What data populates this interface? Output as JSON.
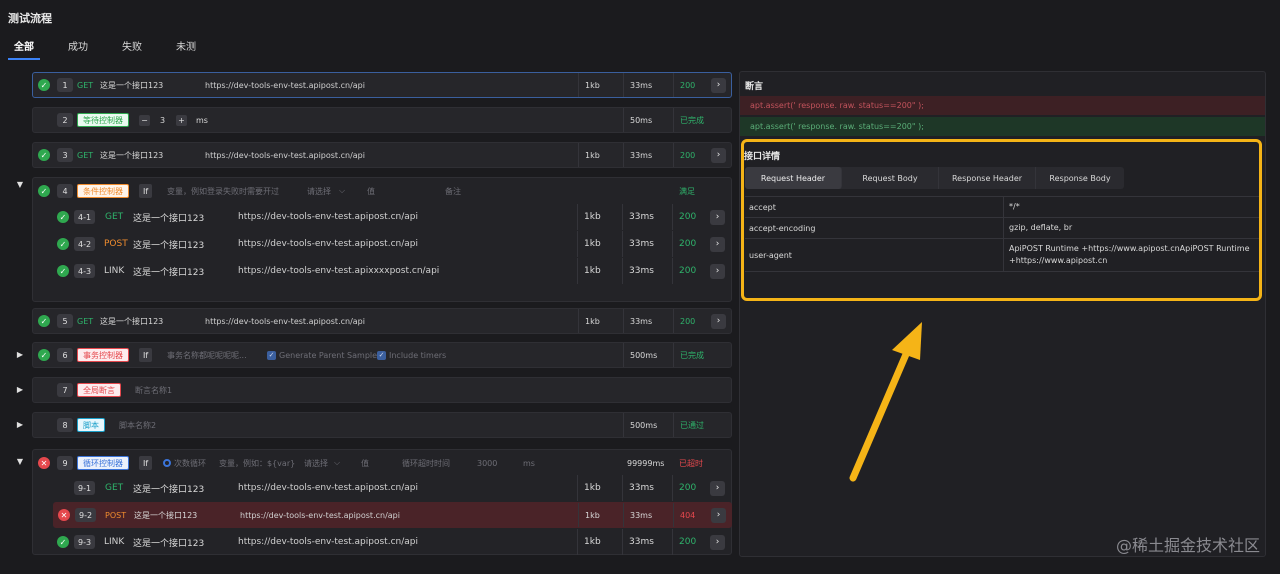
{
  "page": {
    "title": "测试流程"
  },
  "tabs": [
    "全部",
    "成功",
    "失败",
    "未测"
  ],
  "steps": [
    {
      "id": "1",
      "method": "GET",
      "name": "这是一个接口123",
      "url": "https://dev-tools-env-test.apipost.cn/api",
      "size": "1kb",
      "time": "33ms",
      "code": "200",
      "status": "ok"
    },
    {
      "id": "2",
      "tag": "等待控制器",
      "minus": "−",
      "value": "3",
      "plus": "+",
      "unit": "ms",
      "time": "50ms",
      "result": "已完成"
    },
    {
      "id": "3",
      "method": "GET",
      "name": "这是一个接口123",
      "url": "https://dev-tools-env-test.apipost.cn/api",
      "size": "1kb",
      "time": "33ms",
      "code": "200",
      "status": "ok"
    },
    {
      "id": "4",
      "tag": "条件控制器",
      "if": "If",
      "var_placeholder": "变量，例如登录失败时需要开过",
      "select": "请选择",
      "value_placeholder": "值",
      "note_placeholder": "备注",
      "result": "满足",
      "children": [
        {
          "id": "4-1",
          "method": "GET",
          "name": "这是一个接口123",
          "url": "https://dev-tools-env-test.apipost.cn/api",
          "size": "1kb",
          "time": "33ms",
          "code": "200"
        },
        {
          "id": "4-2",
          "method": "POST",
          "name": "这是一个接口123",
          "url": "https://dev-tools-env-test.apipost.cn/api",
          "size": "1kb",
          "time": "33ms",
          "code": "200"
        },
        {
          "id": "4-3",
          "method": "LINK",
          "name": "这是一个接口123",
          "url": "https://dev-tools-env-test.apixxxxpost.cn/api",
          "size": "1kb",
          "time": "33ms",
          "code": "200"
        }
      ]
    },
    {
      "id": "5",
      "method": "GET",
      "name": "这是一个接口123",
      "url": "https://dev-tools-env-test.apipost.cn/api",
      "size": "1kb",
      "time": "33ms",
      "code": "200",
      "status": "ok"
    },
    {
      "id": "6",
      "tag": "事务控制器",
      "if": "If",
      "name_placeholder": "事务名称都呢呢呢呢...",
      "opt1": "Generate Parent Sample",
      "opt2": "Include timers",
      "time": "500ms",
      "result": "已完成"
    },
    {
      "id": "7",
      "tag": "全局断言",
      "name_placeholder": "断言名称1"
    },
    {
      "id": "8",
      "tag": "脚本",
      "name_placeholder": "脚本名称2",
      "time": "500ms",
      "result": "已通过"
    },
    {
      "id": "9",
      "tag": "循环控制器",
      "if": "If",
      "radio": "次数循环",
      "var_placeholder": "变量，例如：${var}",
      "select": "请选择",
      "value_placeholder": "值",
      "timeout_label": "循环超时时间",
      "timeout_value": "3000",
      "timeout_unit": "ms",
      "time": "99999ms",
      "result": "已超时",
      "children": [
        {
          "id": "9-1",
          "method": "GET",
          "name": "这是一个接口123",
          "url": "https://dev-tools-env-test.apipost.cn/api",
          "size": "1kb",
          "time": "33ms",
          "code": "200"
        },
        {
          "id": "9-2",
          "method": "POST",
          "name": "这是一个接口123",
          "url": "https://dev-tools-env-test.apipost.cn/api",
          "size": "1kb",
          "time": "33ms",
          "code": "404"
        },
        {
          "id": "9-3",
          "method": "LINK",
          "name": "这是一个接口123",
          "url": "https://dev-tools-env-test.apipost.cn/api",
          "size": "1kb",
          "time": "33ms",
          "code": "200"
        }
      ]
    }
  ],
  "assertions": {
    "title": "断言",
    "fail": "apt.assert(' response. raw. status==200\" );",
    "pass": "apt.assert(' response. raw. status==200\" );"
  },
  "detail": {
    "title": "接口详情",
    "tabs": [
      "Request Header",
      "Request Body",
      "Response Header",
      "Response Body"
    ],
    "headers": [
      {
        "key": "accept",
        "value": "*/*"
      },
      {
        "key": "accept-encoding",
        "value": "gzip, deflate, br"
      },
      {
        "key": "user-agent",
        "value": "ApiPOST Runtime +https://www.apipost.cnApiPOST Runtime +https://www.apipost.cn"
      }
    ]
  },
  "glyphs": {
    "arrow": "›",
    "check": "✓",
    "cross": "✕",
    "expanded": "▼",
    "collapsed": "▶"
  },
  "watermark": "@稀土掘金技术社区",
  "colors": {
    "accent": "#3b82f6",
    "success": "#2fa84f",
    "error": "#e5484d",
    "highlight": "#f5b417"
  }
}
